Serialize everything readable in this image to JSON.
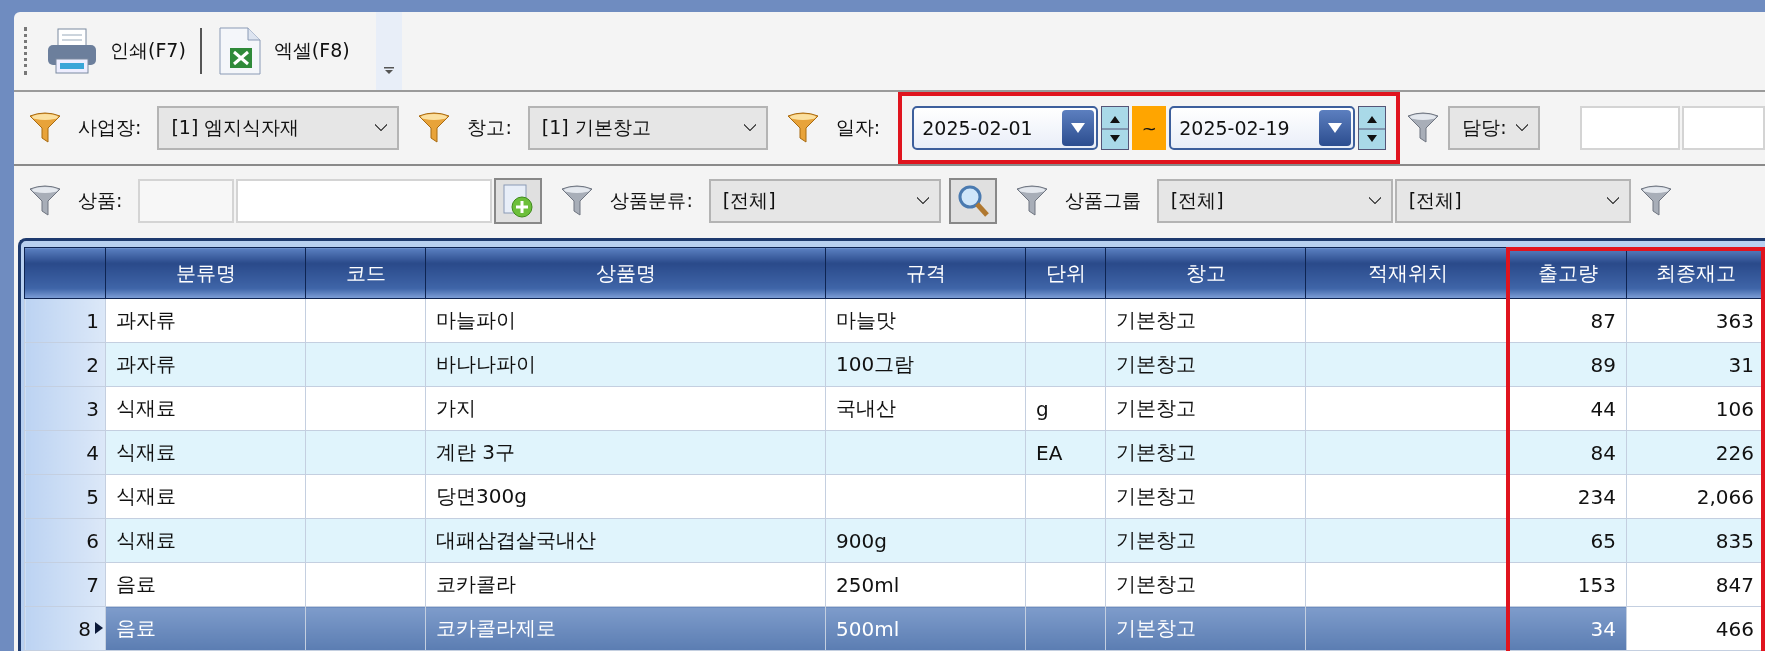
{
  "toolbar": {
    "buttons": [
      {
        "kind": "print",
        "label": "인쇄(F7)"
      },
      {
        "kind": "excel",
        "label": "엑셀(F8)"
      }
    ]
  },
  "filters_top": {
    "business": {
      "label": "사업장:",
      "value": "[1] 엠지식자재",
      "required": true
    },
    "warehouse": {
      "label": "창고:",
      "value": "[1] 기본창고",
      "required": true
    },
    "date": {
      "label": "일자:",
      "from": "2025-02-01",
      "separator": "~",
      "to": "2025-02-19",
      "required": true,
      "highlighted": true
    },
    "manager": {
      "label": "담당:",
      "required": false
    }
  },
  "filters_bottom": {
    "product": {
      "label": "상품:",
      "required": false
    },
    "category": {
      "label": "상품분류:",
      "value": "[전체]",
      "required": false
    },
    "group": {
      "label": "상품그룹",
      "values": [
        "[전체]",
        "[전체]"
      ],
      "required": false
    }
  },
  "table": {
    "columns": [
      {
        "label": "분류명",
        "highlighted": false
      },
      {
        "label": "코드",
        "highlighted": false
      },
      {
        "label": "상품명",
        "highlighted": false
      },
      {
        "label": "규격",
        "highlighted": false
      },
      {
        "label": "단위",
        "highlighted": false
      },
      {
        "label": "창고",
        "highlighted": false
      },
      {
        "label": "적재위치",
        "highlighted": false
      },
      {
        "label": "출고량",
        "highlighted": true
      },
      {
        "label": "최종재고",
        "highlighted": true
      }
    ],
    "rows": [
      {
        "number": "1",
        "selected": false,
        "category": "과자류",
        "name": "마늘파이",
        "spec": "마늘맛",
        "warehouse": "기본창고",
        "shipped": "87",
        "stock": "363"
      },
      {
        "number": "2",
        "selected": false,
        "category": "과자류",
        "name": "바나나파이",
        "spec": "100그람",
        "warehouse": "기본창고",
        "shipped": "89",
        "stock": "31"
      },
      {
        "number": "3",
        "selected": false,
        "category": "식재료",
        "name": "가지",
        "spec": "국내산",
        "unit": "g",
        "warehouse": "기본창고",
        "shipped": "44",
        "stock": "106"
      },
      {
        "number": "4",
        "selected": false,
        "category": "식재료",
        "name": "계란 3구",
        "unit": "EA",
        "warehouse": "기본창고",
        "shipped": "84",
        "stock": "226"
      },
      {
        "number": "5",
        "selected": false,
        "category": "식재료",
        "name": "당면300g",
        "warehouse": "기본창고",
        "shipped": "234",
        "stock": "2,066"
      },
      {
        "number": "6",
        "selected": false,
        "category": "식재료",
        "name": "대패삼겹살국내산",
        "spec": "900g",
        "warehouse": "기본창고",
        "shipped": "65",
        "stock": "835"
      },
      {
        "number": "7",
        "selected": false,
        "category": "음료",
        "name": "코카콜라",
        "spec": "250ml",
        "warehouse": "기본창고",
        "shipped": "153",
        "stock": "847"
      },
      {
        "number": "8",
        "selected": true,
        "stock_cell_focused": true,
        "category": "음료",
        "name": "코카콜라제로",
        "spec": "500ml",
        "warehouse": "기본창고",
        "shipped": "34",
        "stock": "466"
      }
    ]
  }
}
